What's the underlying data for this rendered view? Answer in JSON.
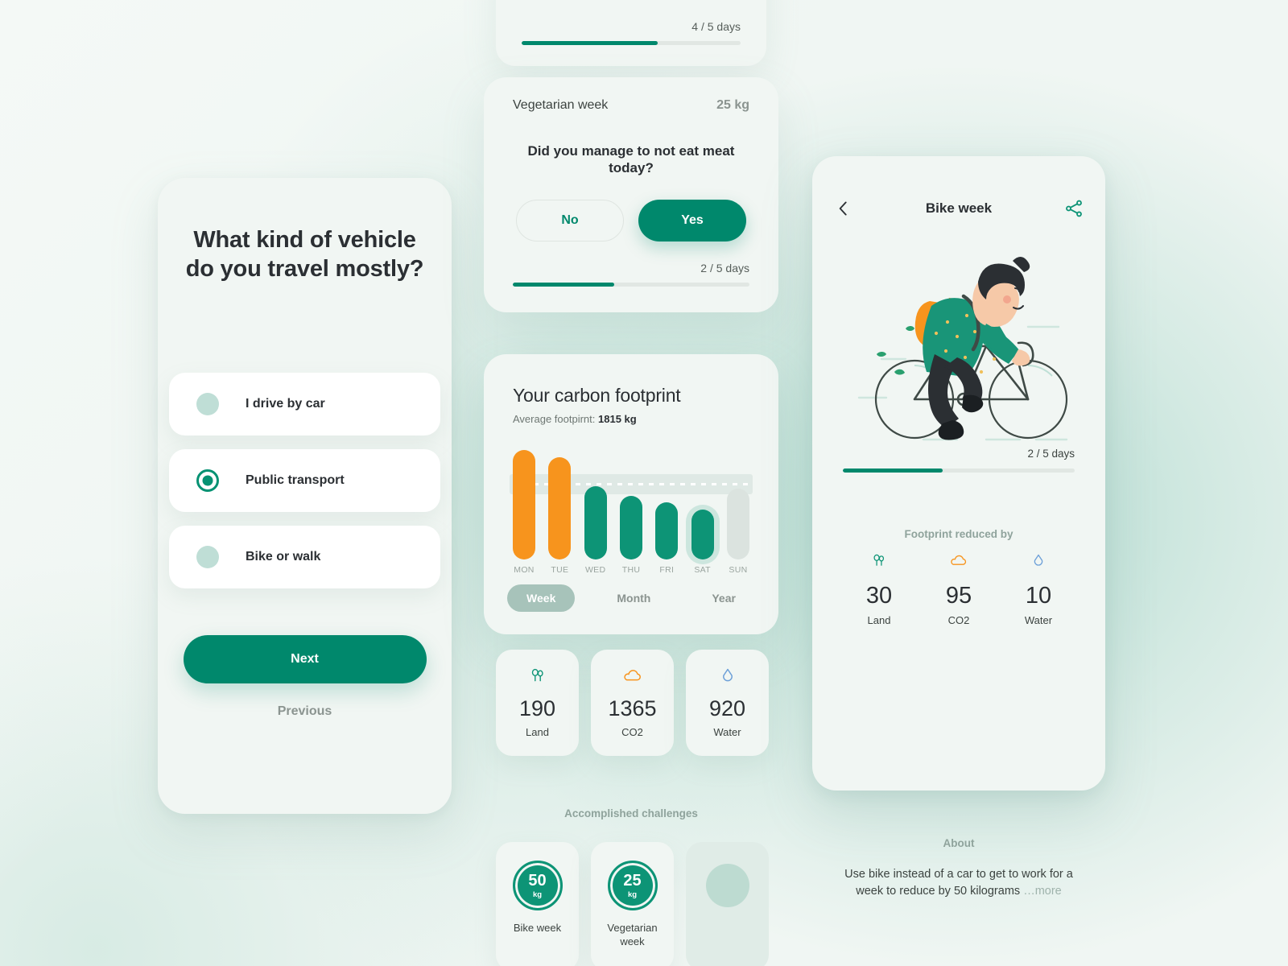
{
  "theme": {
    "primary": "#00886c",
    "primary_light": "#0d9476",
    "accent_orange": "#f7941d",
    "accent_blue": "#6c9fd8",
    "muted": "#8b9490",
    "bg": "#f0f6f3",
    "card": "#f1f6f3"
  },
  "left_panel": {
    "question": "What kind of vehicle\ndo you travel mostly?",
    "question_line1": "What kind of vehicle",
    "question_line2": "do you travel mostly?",
    "options": [
      {
        "label": "I drive by car",
        "selected": false
      },
      {
        "label": "Public transport",
        "selected": true
      },
      {
        "label": "Bike or walk",
        "selected": false
      }
    ],
    "next_label": "Next",
    "previous_label": "Previous"
  },
  "mid_top_card": {
    "progress_label": "4 / 5  days",
    "progress_current": 4,
    "progress_total": 5,
    "progress_percent": 62
  },
  "challenge_card": {
    "name": "Vegetarian week",
    "kg": "25 kg",
    "question_line1": "Did you manage to not eat meat",
    "question_line2": "today?",
    "no_label": "No",
    "yes_label": "Yes",
    "progress_label": "2 / 5  days",
    "progress_current": 2,
    "progress_total": 5,
    "progress_percent": 43
  },
  "chart_card": {
    "title": "Your carbon footprint",
    "subtitle_prefix": "Average footpirnt: ",
    "subtitle_value": "1815 kg",
    "segments": [
      {
        "label": "Week",
        "active": true
      },
      {
        "label": "Month",
        "active": false
      },
      {
        "label": "Year",
        "active": false
      }
    ]
  },
  "chart_data": {
    "type": "bar",
    "title": "Your carbon footprint",
    "subtitle": "Average footpirnt: 1815 kg",
    "xlabel": "",
    "ylabel": "",
    "categories": [
      "MON",
      "TUE",
      "WED",
      "THU",
      "FRI",
      "SAT",
      "SUN"
    ],
    "values": [
      2630,
      2450,
      1750,
      1520,
      1370,
      1190,
      1700
    ],
    "ylim": [
      0,
      2800
    ],
    "average": 1815,
    "average_line": "dotted",
    "grid": false,
    "legend": false,
    "bar_colors": [
      "#f7941d",
      "#f7941d",
      "#0d9476",
      "#0d9476",
      "#0d9476",
      "#0d9476",
      "#dbe3df"
    ],
    "bar_states": [
      "over-average",
      "over-average",
      "normal",
      "normal",
      "normal",
      "selected",
      "empty"
    ],
    "selected_category": "SAT",
    "period": "Week"
  },
  "stat_cards": [
    {
      "icon": "trees-icon",
      "value": "190",
      "label": "Land",
      "color": "#0d9476"
    },
    {
      "icon": "cloud-icon",
      "value": "1365",
      "label": "CO2",
      "color": "#f7941d"
    },
    {
      "icon": "water-drop-icon",
      "value": "920",
      "label": "Water",
      "color": "#6c9fd8"
    }
  ],
  "achievements": {
    "title": "Accomplished challenges",
    "badges": [
      {
        "value": "50",
        "unit": "kg",
        "label": "Bike week",
        "earned": true
      },
      {
        "value": "25",
        "unit": "kg",
        "label": "Vegetarian week",
        "earned": true
      },
      {
        "value": "",
        "unit": "",
        "label": "",
        "earned": false
      }
    ]
  },
  "right_panel": {
    "back_icon": "chevron-left-icon",
    "title": "Bike week",
    "share_icon": "share-icon",
    "illustration": "cyclist-illustration",
    "progress_label": "2 / 5 days",
    "progress_current": 2,
    "progress_total": 5,
    "progress_percent": 43,
    "footprint_title": "Footprint reduced by",
    "stats": [
      {
        "icon": "trees-icon",
        "value": "30",
        "label": "Land",
        "color": "#0d9476"
      },
      {
        "icon": "cloud-icon",
        "value": "95",
        "label": "CO2",
        "color": "#f7941d"
      },
      {
        "icon": "water-drop-icon",
        "value": "10",
        "label": "Water",
        "color": "#6c9fd8"
      }
    ],
    "about_title": "About",
    "about_text": "Use bike instead of a car to get to work for a week to reduce by 50 kilograms ",
    "about_more": "…more"
  }
}
